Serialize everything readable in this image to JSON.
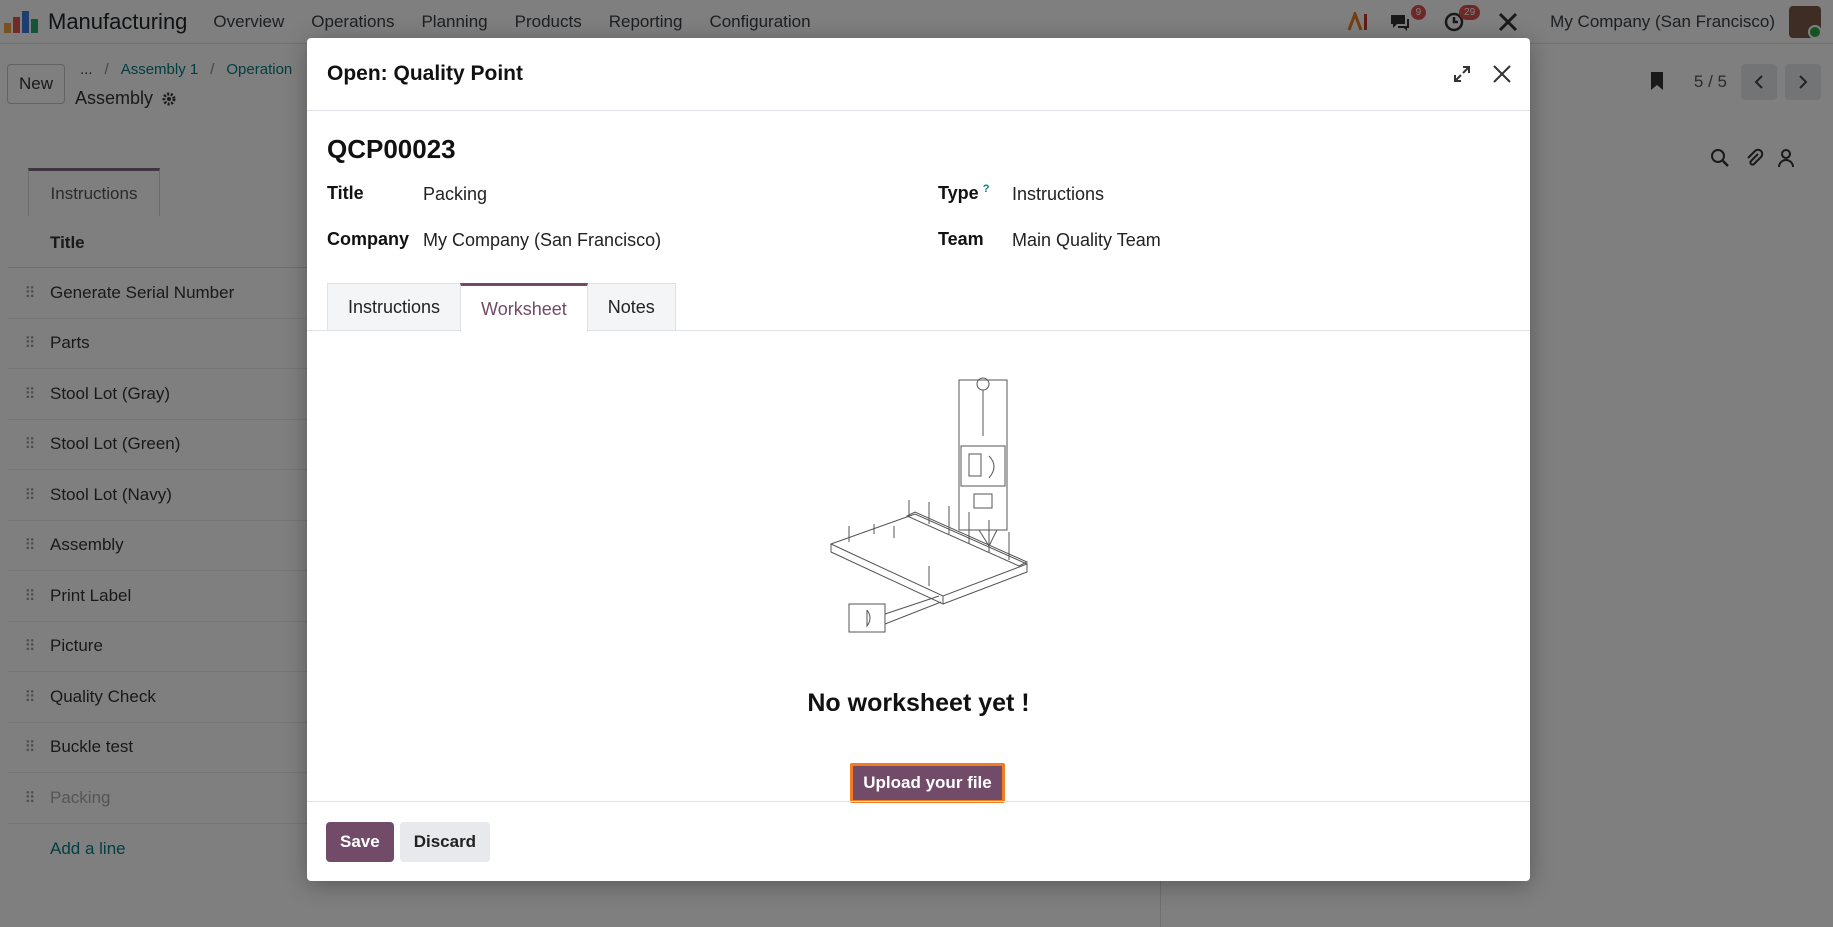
{
  "navbar": {
    "app_name": "Manufacturing",
    "menu": [
      "Overview",
      "Operations",
      "Planning",
      "Products",
      "Reporting",
      "Configuration"
    ],
    "messages_badge": "9",
    "activities_badge": "29",
    "company": "My Company (San Francisco)"
  },
  "control_panel": {
    "new_label": "New",
    "breadcrumb": [
      "...",
      "Assembly 1",
      "Operation"
    ],
    "record_name": "Assembly",
    "pager": "5 / 5"
  },
  "background": {
    "tab_label": "Instructions",
    "list_header": "Title",
    "rows": [
      "Generate Serial Number",
      "Parts",
      "Stool Lot (Gray)",
      "Stool Lot (Green)",
      "Stool Lot (Navy)",
      "Assembly",
      "Print Label",
      "Picture",
      "Quality Check",
      "Buckle test",
      "Packing"
    ],
    "add_line": "Add a line"
  },
  "modal": {
    "title": "Open: Quality Point",
    "reference": "QCP00023",
    "fields": {
      "title_label": "Title",
      "title_value": "Packing",
      "company_label": "Company",
      "company_value": "My Company (San Francisco)",
      "type_label": "Type",
      "type_help": "?",
      "type_value": "Instructions",
      "team_label": "Team",
      "team_value": "Main Quality Team"
    },
    "tabs": [
      "Instructions",
      "Worksheet",
      "Notes"
    ],
    "active_tab": "Worksheet",
    "empty_title": "No worksheet yet !",
    "upload_label": "Upload your file",
    "save_label": "Save",
    "discard_label": "Discard"
  },
  "colors": {
    "primary": "#714b67",
    "link": "#017e84",
    "focus_outline": "#f27c22",
    "badge": "#d9534f"
  }
}
